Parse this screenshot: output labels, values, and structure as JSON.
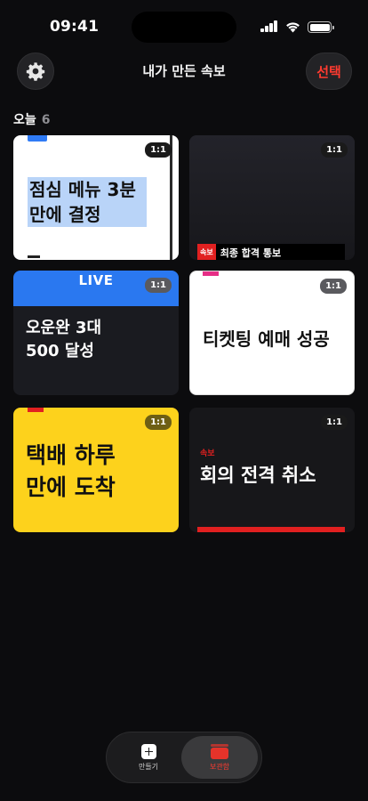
{
  "status_bar": {
    "time": "09:41",
    "icons": [
      "cellular-signal-icon",
      "wifi-icon",
      "battery-icon"
    ]
  },
  "header": {
    "title": "내가 만든 속보",
    "select_label": "선택",
    "settings_icon": "gear-icon"
  },
  "section": {
    "title": "오늘",
    "count": "6"
  },
  "cards": [
    {
      "ratio": "1:1",
      "headline_line1": "점심 메뉴 3분",
      "headline_line2": "만에 결정"
    },
    {
      "ratio": "1:1",
      "caption_tag": "속보",
      "caption_text": "최종 합격 통보"
    },
    {
      "ratio": "1:1",
      "live_label": "LIVE",
      "headline_line1": "오운완 3대",
      "headline_line2": "500 달성"
    },
    {
      "ratio": "1:1",
      "headline": "티켓팅 예매 성공"
    },
    {
      "ratio": "1:1",
      "headline_line1": "택배 하루",
      "headline_line2": "만에 도착"
    },
    {
      "ratio": "1:1",
      "kicker": "속보",
      "headline": "회의 전격 취소"
    }
  ],
  "tab_bar": {
    "create_label": "만들기",
    "archive_label": "보관함",
    "create_icon": "plus-square-icon",
    "archive_icon": "archive-box-icon"
  },
  "colors": {
    "background": "#0c0c0e",
    "accent_red": "#ff3b30",
    "live_blue": "#2a78f0",
    "yellow_card": "#fdd21c",
    "highlight_blue": "#b9d4f8"
  }
}
